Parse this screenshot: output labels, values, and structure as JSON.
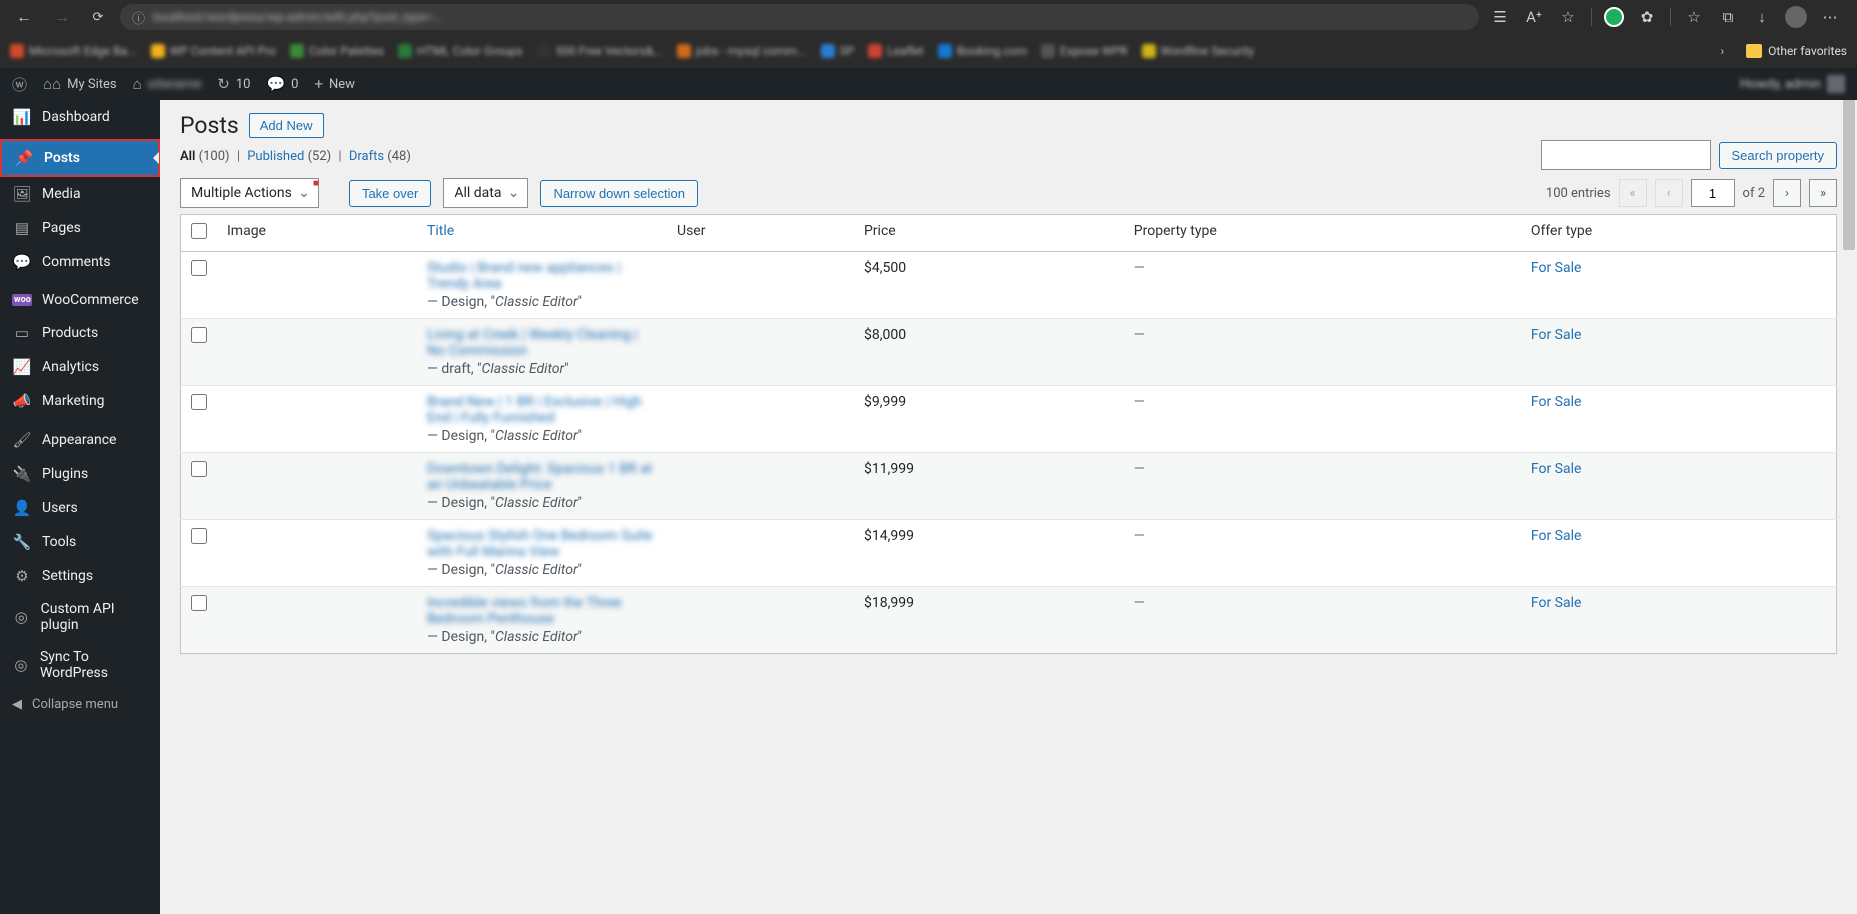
{
  "browser": {
    "url_host_blurred": "localhost/wordpress/wp-admin/edit.php?post_type=...",
    "other_favorites": "Other favorites"
  },
  "adminbar": {
    "my_sites": "My Sites",
    "updates_count": "10",
    "comments_count": "0",
    "new_label": "New",
    "user_greeting": "Howdy, admin"
  },
  "sidebar": {
    "items": [
      {
        "icon": "dashboard",
        "label": "Dashboard"
      },
      {
        "icon": "pin",
        "label": "Posts",
        "current": true
      },
      {
        "icon": "media",
        "label": "Media"
      },
      {
        "icon": "pages",
        "label": "Pages"
      },
      {
        "icon": "comments",
        "label": "Comments"
      },
      {
        "icon": "woo",
        "label": "WooCommerce"
      },
      {
        "icon": "products",
        "label": "Products"
      },
      {
        "icon": "analytics",
        "label": "Analytics"
      },
      {
        "icon": "marketing",
        "label": "Marketing"
      },
      {
        "icon": "appearance",
        "label": "Appearance"
      },
      {
        "icon": "plugins",
        "label": "Plugins"
      },
      {
        "icon": "users",
        "label": "Users"
      },
      {
        "icon": "tools",
        "label": "Tools"
      },
      {
        "icon": "settings",
        "label": "Settings"
      },
      {
        "icon": "api",
        "label": "Custom API plugin"
      },
      {
        "icon": "sync",
        "label": "Sync To WordPress"
      }
    ],
    "collapse": "Collapse menu"
  },
  "page": {
    "title": "Posts",
    "add_new": "Add New"
  },
  "filters": {
    "all_label": "All",
    "all_count": "(100)",
    "published_label": "Published",
    "published_count": "(52)",
    "drafts_label": "Drafts",
    "drafts_count": "(48)",
    "search_button": "Search property",
    "multiple_actions": "Multiple Actions",
    "take_over": "Take over",
    "all_data": "All data",
    "narrow_down": "Narrow down selection",
    "entries_text": "100 entries",
    "page_current": "1",
    "page_of": "of 2"
  },
  "columns": {
    "image": "Image",
    "title": "Title",
    "user": "User",
    "price": "Price",
    "property_type": "Property type",
    "offer_type": "Offer type"
  },
  "rows": [
    {
      "title_blur": "Studio | Brand new appliances | Trendy Area",
      "meta": " — Design, \"",
      "meta_em": "Classic Editor",
      "meta_close": "\"",
      "price": "$4,500",
      "ptype": "—",
      "offer": "For Sale"
    },
    {
      "title_blur": "Living at Creek | Weekly Cleaning | No Commission",
      "meta": " — draft, \"",
      "meta_em": "Classic Editor",
      "meta_close": "\"",
      "price": "$8,000",
      "ptype": "—",
      "offer": "For Sale"
    },
    {
      "title_blur": "Brand New | 1 BR | Exclusive | High End | Fully Furnished",
      "meta": " — Design, \"",
      "meta_em": "Classic Editor",
      "meta_close": "\"",
      "price": "$9,999",
      "ptype": "—",
      "offer": "For Sale"
    },
    {
      "title_blur": "Downtown Delight: Spacious 1 BR at an Unbeatable Price",
      "meta": " — Design, \"",
      "meta_em": "Classic Editor",
      "meta_close": "\"",
      "price": "$11,999",
      "ptype": "—",
      "offer": "For Sale"
    },
    {
      "title_blur": "Spacious Stylish One Bedroom Suite with Full Marina View",
      "meta": " — Design, \"",
      "meta_em": "Classic Editor",
      "meta_close": "\"",
      "price": "$14,999",
      "ptype": "—",
      "offer": "For Sale"
    },
    {
      "title_blur": "Incredible views from the Three Bedroom Penthouse",
      "meta": " — Design, \"",
      "meta_em": "Classic Editor",
      "meta_close": "\"",
      "price": "$18,999",
      "ptype": "—",
      "offer": "For Sale"
    }
  ]
}
